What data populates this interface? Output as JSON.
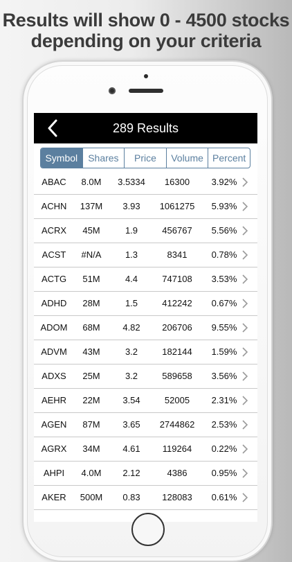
{
  "headline": {
    "line1": "Results will show 0 - 4500 stocks",
    "line2": "depending on your criteria"
  },
  "nav": {
    "back_icon": "chevron-left-icon",
    "title": "289 Results"
  },
  "tabs": [
    {
      "label": "Symbol",
      "selected": true
    },
    {
      "label": "Shares",
      "selected": false
    },
    {
      "label": "Price",
      "selected": false
    },
    {
      "label": "Volume",
      "selected": false
    },
    {
      "label": "Percent",
      "selected": false
    }
  ],
  "colors": {
    "accent": "#5b7f9f",
    "navbar": "#000000",
    "separator": "#c8c8c8"
  },
  "rows": [
    {
      "symbol": "ABAC",
      "shares": "8.0M",
      "price": "3.5334",
      "volume": "16300",
      "percent": "3.92%"
    },
    {
      "symbol": "ACHN",
      "shares": "137M",
      "price": "3.93",
      "volume": "1061275",
      "percent": "5.93%"
    },
    {
      "symbol": "ACRX",
      "shares": "45M",
      "price": "1.9",
      "volume": "456767",
      "percent": "5.56%"
    },
    {
      "symbol": "ACST",
      "shares": "#N/A",
      "price": "1.3",
      "volume": "8341",
      "percent": "0.78%"
    },
    {
      "symbol": "ACTG",
      "shares": "51M",
      "price": "4.4",
      "volume": "747108",
      "percent": "3.53%"
    },
    {
      "symbol": "ADHD",
      "shares": "28M",
      "price": "1.5",
      "volume": "412242",
      "percent": "0.67%"
    },
    {
      "symbol": "ADOM",
      "shares": "68M",
      "price": "4.82",
      "volume": "206706",
      "percent": "9.55%"
    },
    {
      "symbol": "ADVM",
      "shares": "43M",
      "price": "3.2",
      "volume": "182144",
      "percent": "1.59%"
    },
    {
      "symbol": "ADXS",
      "shares": "25M",
      "price": "3.2",
      "volume": "589658",
      "percent": "3.56%"
    },
    {
      "symbol": "AEHR",
      "shares": "22M",
      "price": "3.54",
      "volume": "52005",
      "percent": "2.31%"
    },
    {
      "symbol": "AGEN",
      "shares": "87M",
      "price": "3.65",
      "volume": "2744862",
      "percent": "2.53%"
    },
    {
      "symbol": "AGRX",
      "shares": "34M",
      "price": "4.61",
      "volume": "119264",
      "percent": "0.22%"
    },
    {
      "symbol": "AHPI",
      "shares": "4.0M",
      "price": "2.12",
      "volume": "4386",
      "percent": "0.95%"
    },
    {
      "symbol": "AKER",
      "shares": "500M",
      "price": "0.83",
      "volume": "128083",
      "percent": "0.61%"
    }
  ]
}
